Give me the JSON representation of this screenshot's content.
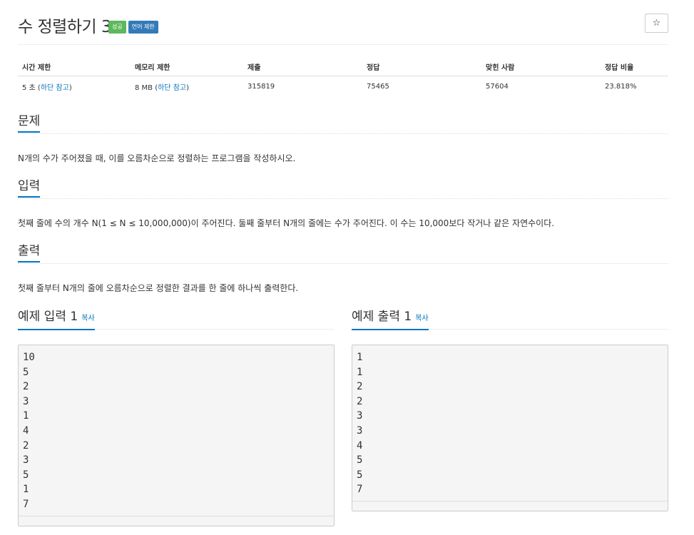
{
  "problem": {
    "title": "수 정렬하기 3",
    "badges": {
      "success": "성공",
      "language": "언어 제한"
    },
    "star": "☆"
  },
  "info": {
    "headers": [
      "시간 제한",
      "메모리 제한",
      "제출",
      "정답",
      "맞힌 사람",
      "정답 비율"
    ],
    "time_limit": "5 초 (",
    "time_link": "하단 참고",
    "memory_limit": "8 MB (",
    "memory_link": "하단 참고",
    "close_paren": ")",
    "submissions": "315819",
    "accepted": "75465",
    "solved_by": "57604",
    "ratio": "23.818%"
  },
  "sections": {
    "problem_heading": "문제",
    "problem_text": "N개의 수가 주어졌을 때, 이를 오름차순으로 정렬하는 프로그램을 작성하시오.",
    "input_heading": "입력",
    "input_text": "첫째 줄에 수의 개수 N(1 ≤ N ≤ 10,000,000)이 주어진다. 둘째 줄부터 N개의 줄에는 수가 주어진다. 이 수는 10,000보다 작거나 같은 자연수이다.",
    "output_heading": "출력",
    "output_text": "첫째 줄부터 N개의 줄에 오름차순으로 정렬한 결과를 한 줄에 하나씩 출력한다."
  },
  "samples": {
    "input_heading": "예제 입력 1",
    "output_heading": "예제 출력 1",
    "copy_label": "복사",
    "input_lines": [
      "10",
      "5",
      "2",
      "3",
      "1",
      "4",
      "2",
      "3",
      "5",
      "1",
      "7"
    ],
    "output_lines": [
      "1",
      "1",
      "2",
      "2",
      "3",
      "3",
      "4",
      "5",
      "5",
      "7"
    ]
  }
}
